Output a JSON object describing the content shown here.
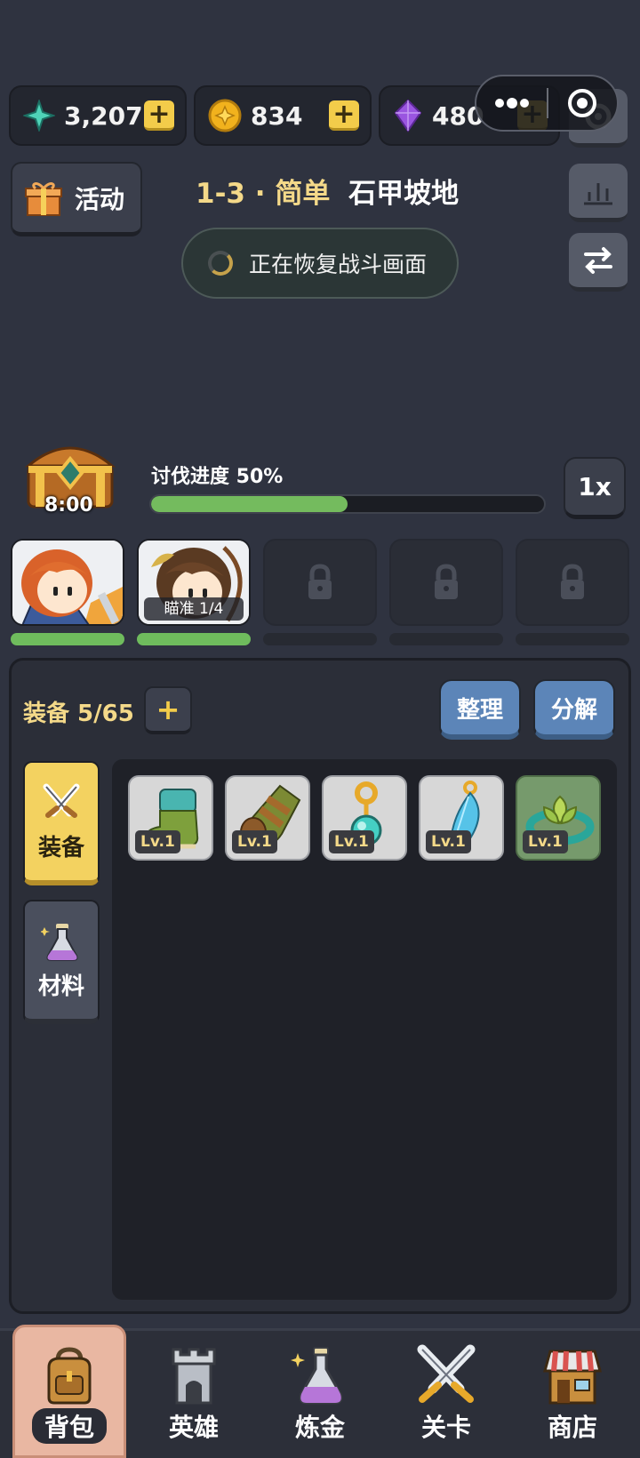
{
  "currency": {
    "gems": "3,207",
    "gold": "834",
    "crystals": "480"
  },
  "event_button": {
    "label": "活动"
  },
  "stage": {
    "number": "1-3 · 简单",
    "name": "石甲坡地"
  },
  "restore": {
    "text": "正在恢复战斗画面"
  },
  "chest": {
    "timer": "8:00"
  },
  "progress": {
    "label": "讨伐进度 50%",
    "percent": 50
  },
  "speed": {
    "label": "1x"
  },
  "heroes": [
    {
      "name": "hero-knight",
      "locked": false,
      "hp_percent": 100
    },
    {
      "name": "hero-archer",
      "locked": false,
      "hp_percent": 100,
      "label": "瞄准 1/4"
    },
    {
      "locked": true
    },
    {
      "locked": true
    },
    {
      "locked": true
    }
  ],
  "bag": {
    "title": "装备 5/65",
    "sort_label": "整理",
    "decompose_label": "分解",
    "tabs": [
      {
        "label": "装备",
        "active": true
      },
      {
        "label": "材料",
        "active": false
      }
    ],
    "items": [
      {
        "type": "boots",
        "level": "Lv.1"
      },
      {
        "type": "gloves",
        "level": "Lv.1"
      },
      {
        "type": "pendant",
        "level": "Lv.1"
      },
      {
        "type": "feather-earring",
        "level": "Lv.1"
      },
      {
        "type": "leaf-ring",
        "level": "Lv.1",
        "rarity": "green"
      }
    ]
  },
  "nav": [
    {
      "label": "背包",
      "active": true
    },
    {
      "label": "英雄",
      "active": false
    },
    {
      "label": "炼金",
      "active": false
    },
    {
      "label": "关卡",
      "active": false
    },
    {
      "label": "商店",
      "active": false
    }
  ],
  "colors": {
    "background": "#2f3340",
    "accent_yellow": "#f3cc4a",
    "progress_green": "#74bb5e",
    "button_blue": "#5c85b8"
  }
}
